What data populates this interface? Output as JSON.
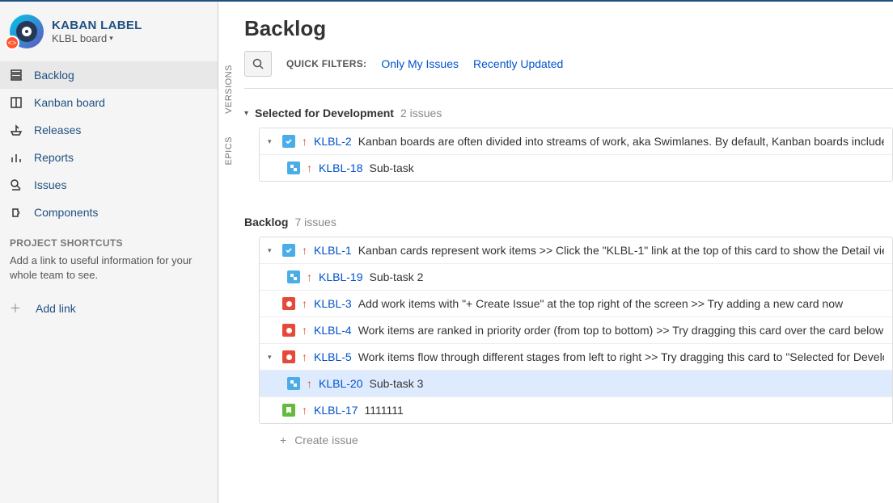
{
  "project": {
    "name": "KABAN LABEL",
    "board": "KLBL board"
  },
  "nav": {
    "backlog": "Backlog",
    "kanban": "Kanban board",
    "releases": "Releases",
    "reports": "Reports",
    "issues": "Issues",
    "components": "Components"
  },
  "shortcuts": {
    "title": "PROJECT SHORTCUTS",
    "desc": "Add a link to useful information for your whole team to see.",
    "add": "Add link"
  },
  "rails": {
    "versions": "VERSIONS",
    "epics": "EPICS"
  },
  "page": {
    "title": "Backlog"
  },
  "filters": {
    "label": "QUICK FILTERS:",
    "only_mine": "Only My Issues",
    "recent": "Recently Updated"
  },
  "selected": {
    "title": "Selected for Development",
    "count": "2 issues",
    "issues": [
      {
        "key": "KLBL-2",
        "summary": "Kanban boards are often divided into streams of work, aka Swimlanes. By default, Kanban boards include an",
        "type": "task",
        "expandable": true
      },
      {
        "key": "KLBL-18",
        "summary": "Sub-task",
        "type": "sub",
        "sub": true
      }
    ]
  },
  "backlog": {
    "title": "Backlog",
    "count": "7 issues",
    "issues": [
      {
        "key": "KLBL-1",
        "summary": "Kanban cards represent work items >> Click the \"KLBL-1\" link at the top of this card to show the Detail view",
        "type": "task",
        "expandable": true
      },
      {
        "key": "KLBL-19",
        "summary": "Sub-task 2",
        "type": "sub",
        "sub": true
      },
      {
        "key": "KLBL-3",
        "summary": "Add work items with \"+ Create Issue\" at the top right of the screen >> Try adding a new card now",
        "type": "bug"
      },
      {
        "key": "KLBL-4",
        "summary": "Work items are ranked in priority order (from top to bottom) >> Try dragging this card over the card below to",
        "type": "bug"
      },
      {
        "key": "KLBL-5",
        "summary": "Work items flow through different stages from left to right >> Try dragging this card to \"Selected for Developm",
        "type": "bug",
        "expandable": true
      },
      {
        "key": "KLBL-20",
        "summary": "Sub-task 3",
        "type": "sub",
        "sub": true,
        "selected": true
      },
      {
        "key": "KLBL-17",
        "summary": "1111111",
        "type": "story"
      }
    ],
    "create": "Create issue"
  }
}
